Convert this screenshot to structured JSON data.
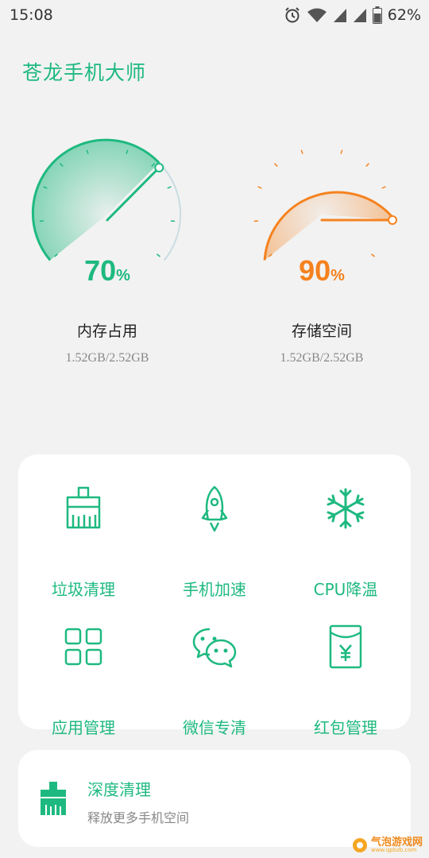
{
  "status_bar": {
    "time": "15:08",
    "battery": "62%",
    "icons": [
      "alarm-icon",
      "wifi-icon",
      "signal-icon",
      "signal-icon",
      "battery-icon"
    ]
  },
  "app": {
    "title": "苍龙手机大师"
  },
  "gauges": [
    {
      "value": "70",
      "unit": "%",
      "label": "内存占用",
      "detail": "1.52GB/2.52GB",
      "color": "#1eb980",
      "level": 0.7
    },
    {
      "value": "90",
      "unit": "%",
      "label": "存储空间",
      "detail": "1.52GB/2.52GB",
      "color": "#f5821f",
      "level": 0.9
    }
  ],
  "tools": [
    {
      "label": "垃圾清理",
      "icon": "broom-icon"
    },
    {
      "label": "手机加速",
      "icon": "rocket-icon"
    },
    {
      "label": "CPU降温",
      "icon": "snowflake-icon"
    },
    {
      "label": "应用管理",
      "icon": "grid-icon"
    },
    {
      "label": "微信专清",
      "icon": "wechat-icon"
    },
    {
      "label": "红包管理",
      "icon": "red-packet-icon"
    }
  ],
  "deep_clean": {
    "title": "深度清理",
    "subtitle": "释放更多手机空间",
    "icon": "deep-clean-icon"
  },
  "watermark": {
    "text": "气泡游戏网",
    "url": "www.qpbzb.com"
  },
  "colors": {
    "accent": "#1eb980",
    "warning": "#f5821f",
    "background": "#f2f2f2"
  }
}
